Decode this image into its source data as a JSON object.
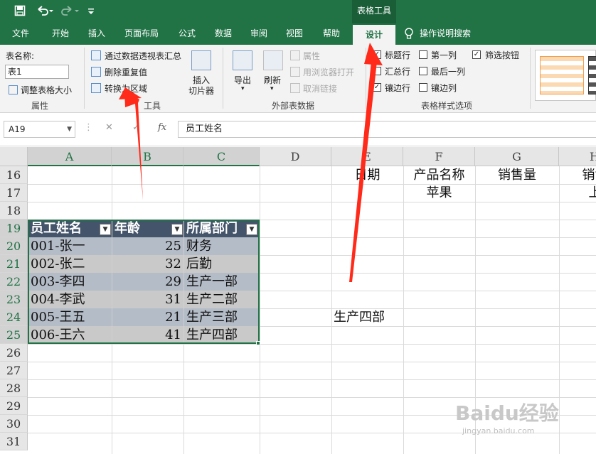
{
  "titlebar": {
    "save_icon": "save-icon",
    "undo_icon": "undo-icon",
    "redo_icon": "redo-icon",
    "customize_icon": "customize-qat-icon",
    "context_tab_group": "表格工具"
  },
  "tabs": [
    {
      "label": "文件"
    },
    {
      "label": "开始"
    },
    {
      "label": "插入"
    },
    {
      "label": "页面布局"
    },
    {
      "label": "公式"
    },
    {
      "label": "数据"
    },
    {
      "label": "审阅"
    },
    {
      "label": "视图"
    },
    {
      "label": "帮助"
    },
    {
      "label": "设计",
      "active": true
    },
    {
      "label": "操作说明搜索"
    }
  ],
  "ribbon": {
    "properties": {
      "table_name_label": "表名称:",
      "table_name_value": "表1",
      "resize_label": "调整表格大小",
      "group_name": "属性"
    },
    "tools": {
      "pivot_label": "通过数据透视表汇总",
      "remove_dup_label": "删除重复值",
      "convert_label": "转换为区域",
      "slicer_label_1": "插入",
      "slicer_label_2": "切片器",
      "group_name": "工具"
    },
    "external": {
      "export_label": "导出",
      "refresh_label": "刷新",
      "properties_label": "属性",
      "open_browser_label": "用浏览器打开",
      "unlink_label": "取消链接",
      "group_name": "外部表数据"
    },
    "style_options": {
      "header_row": "标题行",
      "total_row": "汇总行",
      "banded_rows": "镶边行",
      "first_column": "第一列",
      "last_column": "最后一列",
      "banded_columns": "镶边列",
      "filter_button": "筛选按钮",
      "group_name": "表格样式选项"
    }
  },
  "formula_bar": {
    "name_box": "A19",
    "fx": "fx",
    "content": "员工姓名"
  },
  "columns": [
    "A",
    "B",
    "C",
    "D",
    "E",
    "F",
    "G",
    "H"
  ],
  "rows": [
    "16",
    "17",
    "18",
    "19",
    "20",
    "21",
    "22",
    "23",
    "24",
    "25",
    "26",
    "27",
    "28",
    "29",
    "30",
    "31"
  ],
  "cells": {
    "e16": "日期",
    "f16": "产品名称",
    "g16": "销售量",
    "h16": "销售",
    "f17": "苹果",
    "h17": "上",
    "e24": "生产四部"
  },
  "table": {
    "headers": [
      "员工姓名",
      "年龄",
      "所属部门"
    ],
    "rows": [
      {
        "name": "001-张一",
        "age": "25",
        "dept": "财务"
      },
      {
        "name": "002-张二",
        "age": "32",
        "dept": "后勤"
      },
      {
        "name": "003-李四",
        "age": "29",
        "dept": "生产一部"
      },
      {
        "name": "004-李武",
        "age": "31",
        "dept": "生产二部"
      },
      {
        "name": "005-王五",
        "age": "21",
        "dept": "生产三部"
      },
      {
        "name": "006-王六",
        "age": "41",
        "dept": "生产四部"
      }
    ]
  },
  "watermark": {
    "brand": "Baidu经验",
    "url": "jingyan.baidu.com"
  },
  "colors": {
    "excel_green": "#217346",
    "table_header": "#44546a",
    "table_band_dark": "#b4bcc7",
    "table_band_light": "#c9c9c9",
    "arrow_red": "#ff2a1a"
  }
}
